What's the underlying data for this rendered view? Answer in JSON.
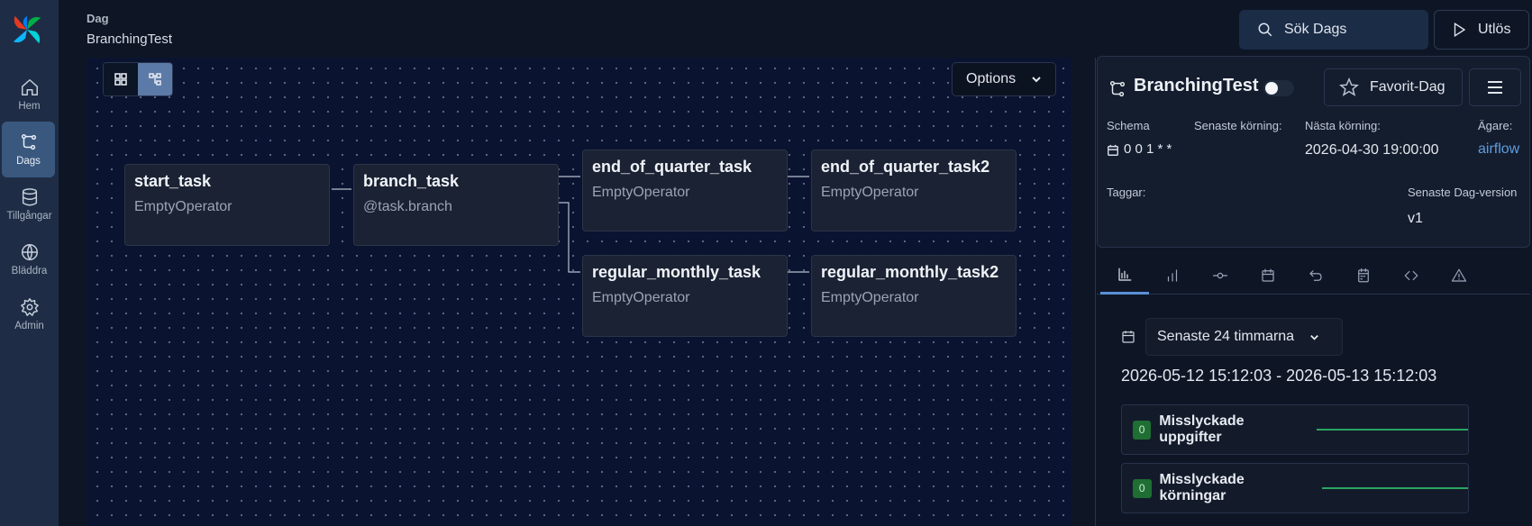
{
  "nav": {
    "items": [
      {
        "label": "Hem",
        "icon": "home-icon"
      },
      {
        "label": "Dags",
        "icon": "dags-icon"
      },
      {
        "label": "Tillgångar",
        "icon": "database-icon"
      },
      {
        "label": "Bläddra",
        "icon": "globe-icon"
      },
      {
        "label": "Admin",
        "icon": "gear-icon"
      }
    ],
    "active": "Dags"
  },
  "breadcrumb": {
    "section": "Dag",
    "name": "BranchingTest"
  },
  "topbar": {
    "search_label": "Sök Dags",
    "trigger_label": "Utlös"
  },
  "graph": {
    "options_label": "Options",
    "nodes": [
      {
        "id": "start_task",
        "title": "start_task",
        "subtitle": "EmptyOperator"
      },
      {
        "id": "branch_task",
        "title": "branch_task",
        "subtitle": "@task.branch"
      },
      {
        "id": "end_of_quarter_task",
        "title": "end_of_quarter_task",
        "subtitle": "EmptyOperator"
      },
      {
        "id": "end_of_quarter_task2",
        "title": "end_of_quarter_task2",
        "subtitle": "EmptyOperator"
      },
      {
        "id": "regular_monthly_task",
        "title": "regular_monthly_task",
        "subtitle": "EmptyOperator"
      },
      {
        "id": "regular_monthly_task2",
        "title": "regular_monthly_task2",
        "subtitle": "EmptyOperator"
      }
    ]
  },
  "details": {
    "title": "BranchingTest",
    "favorite_label": "Favorit-Dag",
    "schedule_label": "Schema",
    "schedule_value": "0 0 1 * *",
    "last_run_label": "Senaste körning:",
    "next_run_label": "Nästa körning:",
    "next_run_value": "2026-04-30 19:00:00",
    "owner_label": "Ägare:",
    "owner_value": "airflow",
    "tags_label": "Taggar:",
    "version_label": "Senaste Dag-version",
    "version_value": "v1"
  },
  "tabs": [
    "overview-icon",
    "bar-chart-icon",
    "commit-icon",
    "calendar-icon",
    "undo-icon",
    "clipboard-calendar-icon",
    "code-icon",
    "warning-icon"
  ],
  "overview": {
    "range_label": "Senaste 24 timmarna",
    "range_text": "2026-05-12 15:12:03 - 2026-05-13 15:12:03",
    "stats": [
      {
        "count": "0",
        "label": "Misslyckade uppgifter"
      },
      {
        "count": "0",
        "label": "Misslyckade körningar"
      }
    ]
  },
  "colors": {
    "accent": "#5a90d6",
    "success": "#2aa561",
    "sidebar": "#1e2d45",
    "canvas": "#0a1330"
  }
}
